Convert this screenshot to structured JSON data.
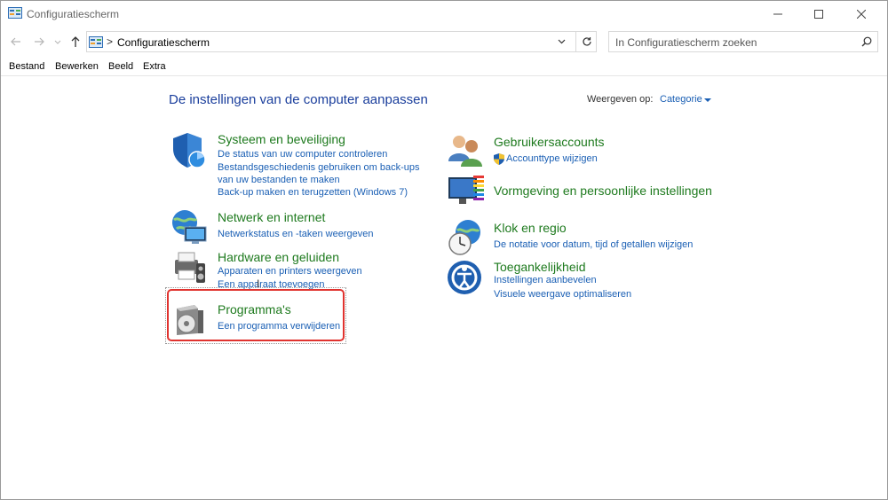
{
  "window": {
    "title": "Configuratiescherm"
  },
  "address": {
    "path": "Configuratiescherm",
    "separator": ">"
  },
  "search": {
    "placeholder": "In Configuratiescherm zoeken"
  },
  "menu": [
    "Bestand",
    "Bewerken",
    "Beeld",
    "Extra"
  ],
  "content": {
    "heading": "De instellingen van de computer aanpassen",
    "view_label": "Weergeven op:",
    "view_value": "Categorie"
  },
  "categories": {
    "system": {
      "title": "Systeem en beveiliging",
      "links": [
        "De status van uw computer controleren",
        "Bestandsgeschiedenis gebruiken om back-ups van uw bestanden te maken",
        "Back-up maken en terugzetten (Windows 7)"
      ]
    },
    "network": {
      "title": "Netwerk en internet",
      "links": [
        "Netwerkstatus en -taken weergeven"
      ]
    },
    "hardware": {
      "title": "Hardware en geluiden",
      "links": [
        "Apparaten en printers weergeven",
        "Een apparaat toevoegen"
      ]
    },
    "programs": {
      "title": "Programma's",
      "links": [
        "Een programma verwijderen"
      ]
    },
    "users": {
      "title": "Gebruikersaccounts",
      "links": [
        "Accounttype wijzigen"
      ]
    },
    "appearance": {
      "title": "Vormgeving en persoonlijke instellingen",
      "links": []
    },
    "clock": {
      "title": "Klok en regio",
      "links": [
        "De notatie voor datum, tijd of getallen wijzigen"
      ]
    },
    "ease": {
      "title": "Toegankelijkheid",
      "links": [
        "Instellingen aanbevelen",
        "Visuele weergave optimaliseren"
      ]
    }
  },
  "colors": {
    "link": "#1a5fb4",
    "category_title": "#1e7a1e",
    "heading": "#1a3e9c",
    "highlight": "#e0332f"
  }
}
